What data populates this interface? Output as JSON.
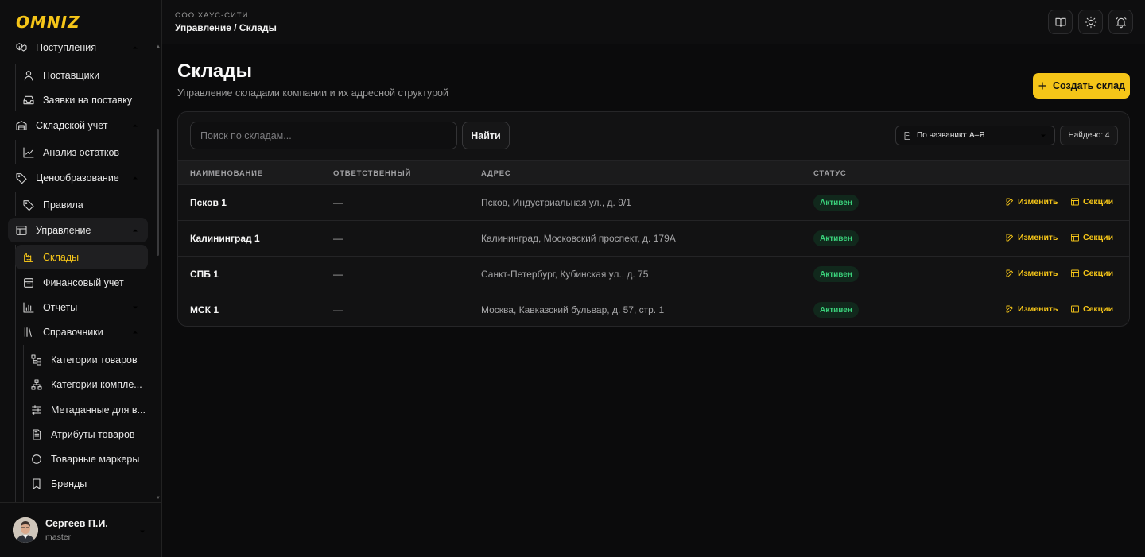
{
  "app": {
    "logo": "OMNIZ",
    "accent": "#f5c518"
  },
  "header": {
    "company": "ООО ХАУС-СИТИ",
    "breadcrumb": "Управление / Склады",
    "icons": [
      "book-icon",
      "sun-icon",
      "bell-icon"
    ]
  },
  "sidebar": {
    "items": [
      {
        "label": "Поступления",
        "icon": "boxes-icon",
        "level": 0,
        "expanded": true
      },
      {
        "label": "Поставщики",
        "icon": "user-icon",
        "level": 1
      },
      {
        "label": "Заявки на поставку",
        "icon": "inbox-icon",
        "level": 1
      },
      {
        "label": "Складской учет",
        "icon": "warehouse-icon",
        "level": 0,
        "expanded": true
      },
      {
        "label": "Анализ остатков",
        "icon": "chart-line-icon",
        "level": 1
      },
      {
        "label": "Ценообразование",
        "icon": "tags-icon",
        "level": 0,
        "expanded": true
      },
      {
        "label": "Правила",
        "icon": "tag-icon",
        "level": 1
      },
      {
        "label": "Управление",
        "icon": "layout-icon",
        "level": 0,
        "expanded": true
      },
      {
        "label": "Склады",
        "icon": "warehouse-small-icon",
        "level": 1,
        "active": true
      },
      {
        "label": "Финансовый учет",
        "icon": "archive-icon",
        "level": 1
      },
      {
        "label": "Отчеты",
        "icon": "bar-chart-icon",
        "level": 1,
        "expanded": false
      },
      {
        "label": "Справочники",
        "icon": "library-icon",
        "level": 1,
        "expanded": true
      },
      {
        "label": "Категории товаров",
        "icon": "tree-icon",
        "level": 2
      },
      {
        "label": "Категории компле...",
        "icon": "network-icon",
        "level": 2
      },
      {
        "label": "Метаданные для в...",
        "icon": "sliders-icon",
        "level": 2
      },
      {
        "label": "Атрибуты товаров",
        "icon": "file-text-icon",
        "level": 2
      },
      {
        "label": "Товарные маркеры",
        "icon": "circle-icon",
        "level": 2
      },
      {
        "label": "Бренды",
        "icon": "bookmark-icon",
        "level": 2
      }
    ]
  },
  "user": {
    "name": "Сергеев П.И.",
    "role": "master"
  },
  "page": {
    "title": "Склады",
    "subtitle": "Управление складами компании и их адресной структурой",
    "create_label": "Создать склад"
  },
  "toolbar": {
    "search_placeholder": "Поиск по складам...",
    "search_value": "",
    "find_label": "Найти",
    "sort_value": "По названию: А–Я",
    "found_label": "Найдено: 4"
  },
  "table": {
    "columns": [
      "НАИМЕНОВАНИЕ",
      "ОТВЕТСТВЕННЫЙ",
      "АДРЕС",
      "СТАТУС"
    ],
    "edit_label": "Изменить",
    "sections_label": "Секции",
    "rows": [
      {
        "name": "Псков 1",
        "responsible": "—",
        "address": "Псков, Индустриальная ул., д. 9/1",
        "status": "Активен"
      },
      {
        "name": "Калининград 1",
        "responsible": "—",
        "address": "Калининград, Московский проспект, д. 179А",
        "status": "Активен"
      },
      {
        "name": "СПБ 1",
        "responsible": "—",
        "address": "Санкт-Петербург, Кубинская ул., д. 75",
        "status": "Активен"
      },
      {
        "name": "МСК 1",
        "responsible": "—",
        "address": "Москва, Кавказский бульвар, д. 57, стр. 1",
        "status": "Активен"
      }
    ]
  }
}
